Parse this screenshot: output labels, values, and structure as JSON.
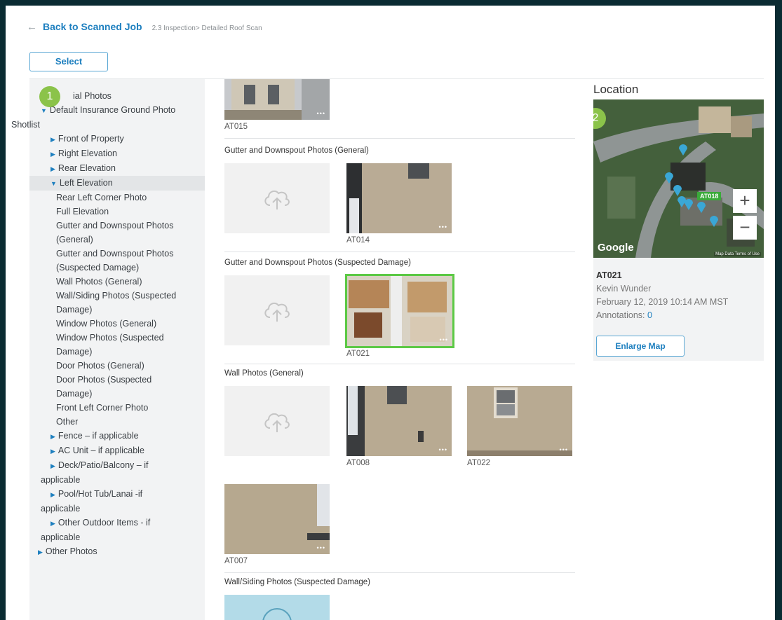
{
  "header": {
    "back_label": "Back to Scanned Job",
    "breadcrumb": "2.3 Inspection> Detailed Roof Scan"
  },
  "select_label": "Select",
  "tree": {
    "badge": "1",
    "aerial": "ial Photos",
    "default_shotlist_a": "Default Insurance Ground Photo",
    "default_shotlist_b": "Shotlist",
    "front": "Front of Property",
    "right": "Right Elevation",
    "rear": "Rear Elevation",
    "left": "Left Elevation",
    "left_children": [
      "Rear Left Corner Photo",
      "Full Elevation",
      "Gutter and Downspout Photos",
      "(General)",
      "Gutter and Downspout Photos",
      "(Suspected Damage)",
      "Wall Photos (General)",
      "Wall/Siding Photos (Suspected",
      "Damage)",
      "Window Photos (General)",
      "Window Photos (Suspected",
      "Damage)",
      "Door Photos (General)",
      "Door Photos (Suspected",
      "Damage)",
      "Front Left Corner Photo",
      "Other"
    ],
    "fence": "Fence – if applicable",
    "ac": "AC Unit – if applicable",
    "deck_a": "Deck/Patio/Balcony – if",
    "deck_b": "applicable",
    "pool_a": "Pool/Hot Tub/Lanai -if",
    "pool_b": "applicable",
    "outdoor_a": "Other Outdoor Items - if",
    "outdoor_b": "applicable",
    "other_photos": "Other Photos"
  },
  "sections": {
    "gutter_general": "Gutter and Downspout Photos (General)",
    "gutter_damage": "Gutter and Downspout Photos (Suspected Damage)",
    "wall_general": "Wall Photos (General)",
    "wall_siding_damage": "Wall/Siding Photos (Suspected Damage)"
  },
  "photos": {
    "at015": "AT015",
    "at014": "AT014",
    "at021": "AT021",
    "at008": "AT008",
    "at022": "AT022",
    "at007": "AT007"
  },
  "location": {
    "title": "Location",
    "badge": "2",
    "map_tag": "AT018",
    "zoom_in": "+",
    "zoom_out": "−",
    "google": "Google",
    "map_footer": "Map Data   Terms of Use",
    "code": "AT021",
    "person": "Kevin Wunder",
    "datetime": "February 12, 2019 10:14 AM MST",
    "annotations_label": "Annotations: ",
    "annotations_count": "0",
    "enlarge_label": "Enlarge Map"
  },
  "colors": {
    "accent": "#1d7fbf",
    "badge": "#8bc34a",
    "selected_border": "#5cc945",
    "page_bg": "#0a2b32"
  }
}
